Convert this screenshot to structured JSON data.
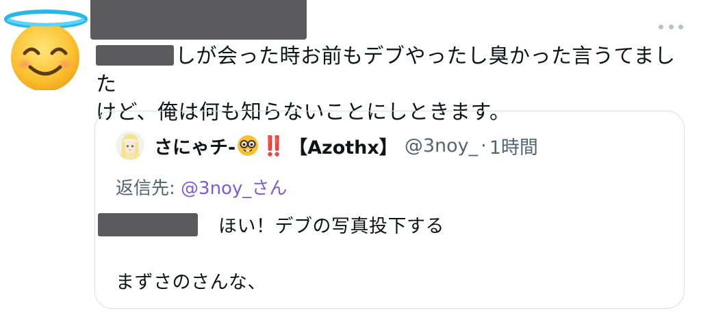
{
  "tweet": {
    "text_line1_after_redaction": "しが会った時お前もデブやったし臭かった言うてました",
    "text_line2": "けど、俺は何も知らないことにしときます。"
  },
  "quote": {
    "display_name": "さにゃチ-",
    "emoji_bangbang": "‼️",
    "tag": "【Azothx】",
    "handle": "@3noy_",
    "separator": "·",
    "time": "1時間",
    "reply_prefix": "返信先: ",
    "reply_mention": "@3noy_さん",
    "line1": "ほい！デブの写真投下する",
    "line2": "まずさのさんな、"
  },
  "icons": {
    "author_avatar": "smiling-face-with-halo-icon",
    "more": "more-horizontal-icon",
    "quote_avatar": "anime-avatar",
    "nerd": "nerd-face-icon"
  },
  "colors": {
    "redaction": "#5b5b5e",
    "mention": "#7d5bd6",
    "secondary_text": "#536471",
    "border": "#d8dee3"
  }
}
